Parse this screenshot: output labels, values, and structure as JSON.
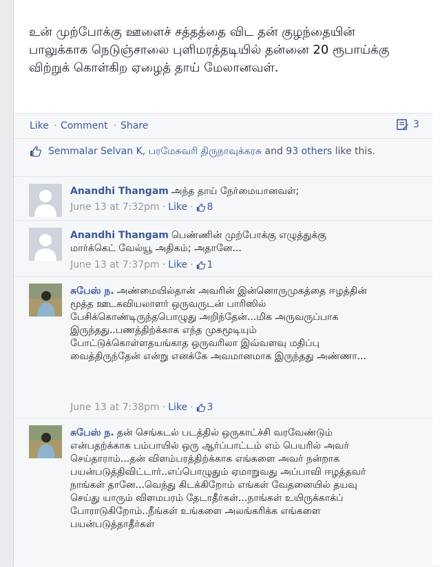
{
  "post": {
    "text": "உன் முற்போக்கு ஊளைச் சத்தத்தை விட தன் குழந்தையின் பாலுக்காக நெடுஞ்சாலை புளிமரத்தடியில் தன்னை 20 ரூபாய்க்கு விற்றுக் கொள்கிற ஏழைத் தாய் மேலானவள்."
  },
  "actions": {
    "like": "Like",
    "comment": "Comment",
    "share": "Share",
    "separator": "·",
    "share_count": "3"
  },
  "likes": {
    "name1": "Semmalar Selvan K",
    "comma": ", ",
    "name2": "பரமேசுவரி திருநாவுக்கரசு",
    "and": " and ",
    "others": "93 others",
    "tail": " like this."
  },
  "comments": [
    {
      "author": "Anandhi Thangam",
      "text": "அந்த தாய் நேர்மையானவள்;",
      "time": "June 13 at 7:32pm",
      "like_label": "Like",
      "likes": "8"
    },
    {
      "author": "Anandhi Thangam",
      "text": "பெண்ணின் முற்போக்கு எழுத்துக்கு மார்க்கெட் வேல்யூ அதிகம்; அதானே...",
      "time": "June 13 at 7:37pm",
      "like_label": "Like",
      "likes": "1"
    },
    {
      "author": "சுபேஸ் ந.",
      "text": "அண்மையில்தான் அவரின் இன்னொருமுகத்தை ஈழத்தின் மூத்த ஊடகவியலாளர் ஒருவருடன் பாரிஸில் பேசிக்கொண்டிருந்தபொழுது அறிந்தேன்...மிக அருவருப்பாக இருந்தது..பணத்திற்க்காக எந்த முகமூடியும் போட்டுக்கொள்ளதயங்காத ஒருவரிலா இவ்வளவு மதிப்பு வைத்திருந்தேன் என்று எனக்கே அவமானமாக இருந்தது அண்ணா...",
      "time": "June 13 at 7:38pm",
      "like_label": "Like",
      "likes": "3"
    },
    {
      "author": "சுபேஸ் ந.",
      "text": "தன் செங்கடல் படத்தில் ஒருகாட்ச்சி வரவேண்டும் என்பதற்க்காக பம்பாயில் ஒரு ஆர்ப்பாட்டம் எம் பெயரில் அவர் செய்தாராம்...தன் விளம்பரத்திற்க்காக எங்களை அவர் நன்றாக பயன்படுத்திவிட்டார்..எப்பொழுதும் ஏமாறுவது அப்பாவி ஈழத்தவர் நாங்கள் தானே...வெந்து கிடக்கிறோம் எங்கள் வேதனையில் தயவு செய்து யாரும் விளமபரம் தேடாதீர்கள்...நாங்கள் உயிருக்காக்ப் போராடுகிறோம்..நீங்கள் உங்களை அலங்கரிக்க எங்களை பயன்படுத்தாதீர்கள்"
    }
  ]
}
